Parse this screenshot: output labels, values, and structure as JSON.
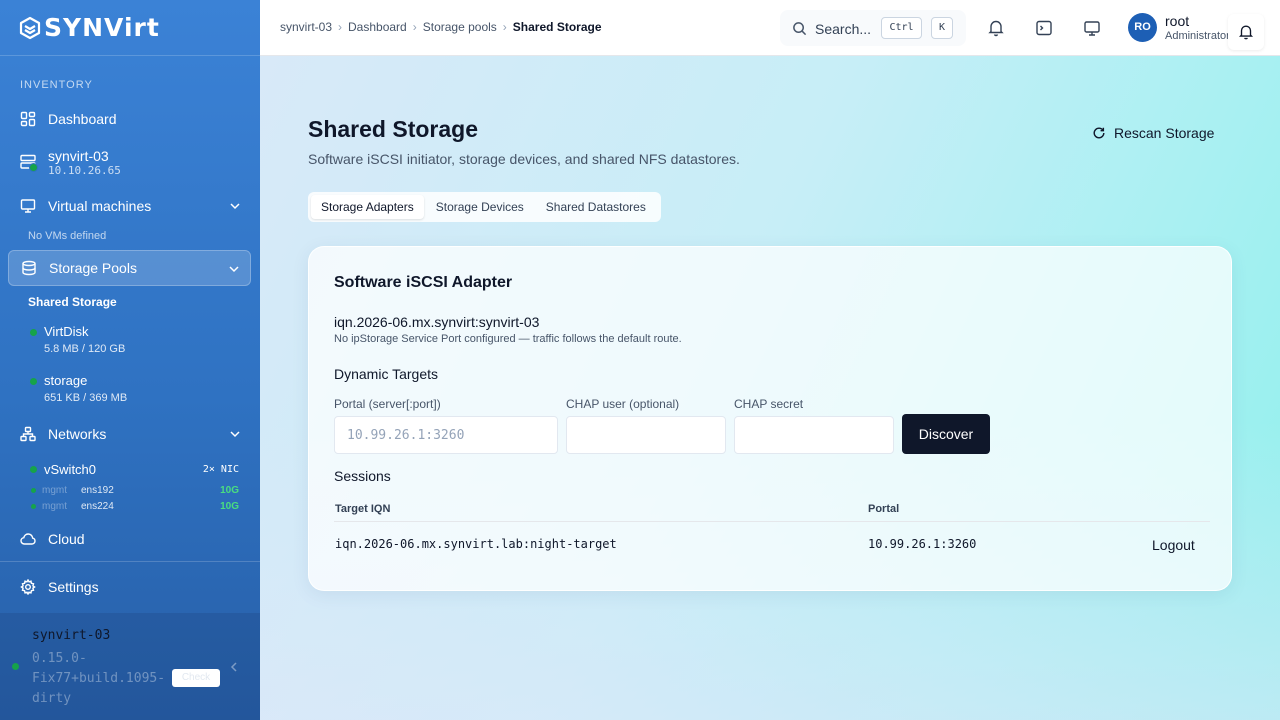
{
  "brand": {
    "name": "SYNVirt"
  },
  "sidebar": {
    "section_label": "INVENTORY",
    "dashboard": "Dashboard",
    "host": {
      "name": "synvirt-03",
      "ip": "10.10.26.65",
      "status_color": "#16a34a"
    },
    "virtual_machines": "Virtual machines",
    "no_vms": "No VMs defined",
    "storage_pools": "Storage Pools",
    "shared_storage": "Shared Storage",
    "pools": [
      {
        "name": "VirtDisk",
        "size": "5.8 MB / 120 GB"
      },
      {
        "name": "storage",
        "size": "651 KB / 369 MB"
      }
    ],
    "networks": "Networks",
    "vswitch": {
      "name": "vSwitch0",
      "nic_count": "2× NIC",
      "nics": [
        {
          "role": "mgmt",
          "name": "ens192",
          "speed": "10G"
        },
        {
          "role": "mgmt",
          "name": "ens224",
          "speed": "10G"
        }
      ]
    },
    "cloud": "Cloud",
    "settings": "Settings",
    "footer": {
      "hostname": "synvirt-03",
      "version": "0.15.0-Fix77+build.1095-dirty",
      "check_label": "Check"
    }
  },
  "topbar": {
    "breadcrumb": [
      "synvirt-03",
      "Dashboard",
      "Storage pools",
      "Shared Storage"
    ],
    "search_placeholder": "Search...",
    "kbd_ctrl": "Ctrl",
    "kbd_k": "K",
    "user": {
      "initials": "RO",
      "name": "root",
      "role": "Administrator"
    }
  },
  "page": {
    "title": "Shared Storage",
    "subtitle": "Software iSCSI initiator, storage devices, and shared NFS datastores.",
    "rescan_label": "Rescan Storage",
    "tabs": [
      "Storage Adapters",
      "Storage Devices",
      "Shared Datastores"
    ],
    "active_tab": "Storage Adapters"
  },
  "adapter": {
    "title": "Software iSCSI Adapter",
    "iqn": "iqn.2026-06.mx.synvirt:synvirt-03",
    "note": "No ipStorage Service Port configured — traffic follows the default route.",
    "dynamic_targets_label": "Dynamic Targets",
    "portal_label": "Portal (server[:port])",
    "portal_placeholder": "10.99.26.1:3260",
    "chap_user_label": "CHAP user (optional)",
    "chap_secret_label": "CHAP secret",
    "discover_label": "Discover",
    "sessions_label": "Sessions",
    "columns": [
      "Target IQN",
      "Portal"
    ],
    "sessions": [
      {
        "target": "iqn.2026-06.mx.synvirt.lab:night-target",
        "portal": "10.99.26.1:3260",
        "action": "Logout"
      }
    ]
  }
}
